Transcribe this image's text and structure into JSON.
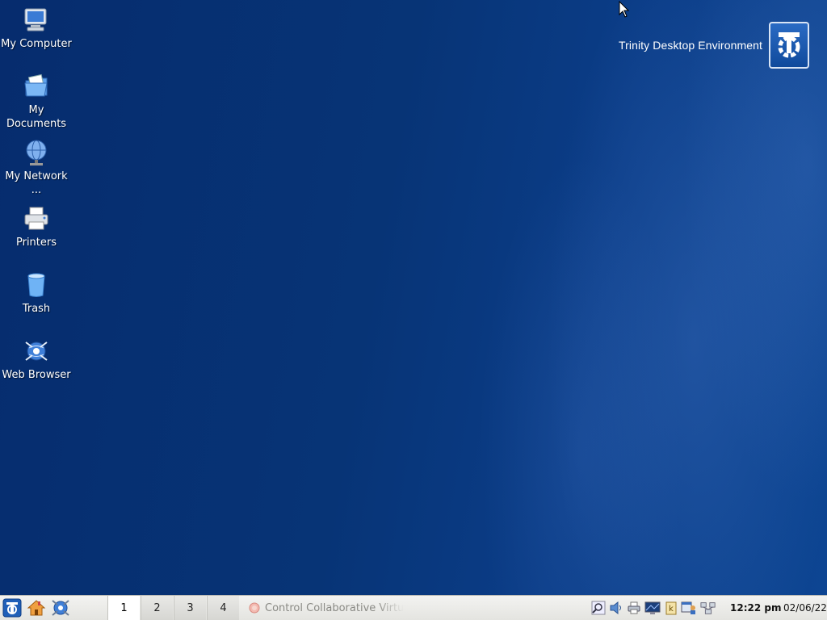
{
  "desktop": {
    "icons": [
      {
        "label": "My Computer",
        "icon": "computer-icon"
      },
      {
        "label": "My Documents",
        "icon": "documents-folder-icon"
      },
      {
        "label": "My Network ...",
        "icon": "network-globe-icon"
      },
      {
        "label": "Printers",
        "icon": "printer-icon"
      },
      {
        "label": "Trash",
        "icon": "trash-icon"
      },
      {
        "label": "Web Browser",
        "icon": "web-browser-icon"
      }
    ],
    "branding": {
      "text": "Trinity Desktop Environment",
      "logo": "trinity-logo-icon"
    },
    "colors": {
      "background": "#0a3a82",
      "taskbar": "#ecece9"
    }
  },
  "taskbar": {
    "launchers": [
      {
        "name": "trinity-menu",
        "icon": "trinity-menu-icon"
      },
      {
        "name": "home",
        "icon": "home-folder-icon"
      },
      {
        "name": "web-browser",
        "icon": "web-browser-icon"
      }
    ],
    "desktops": [
      "1",
      "2",
      "3",
      "4"
    ],
    "active_desktop": "1",
    "task": {
      "label": "Control Collaborative Virtu",
      "icon": "task-app-icon"
    },
    "tray": [
      "search-icon",
      "volume-icon",
      "printer-tray-icon",
      "display-icon",
      "clipboard-icon",
      "user-switch-icon",
      "network-icon"
    ],
    "clock": {
      "time": "12:22 pm",
      "date": "02/06/22"
    }
  }
}
